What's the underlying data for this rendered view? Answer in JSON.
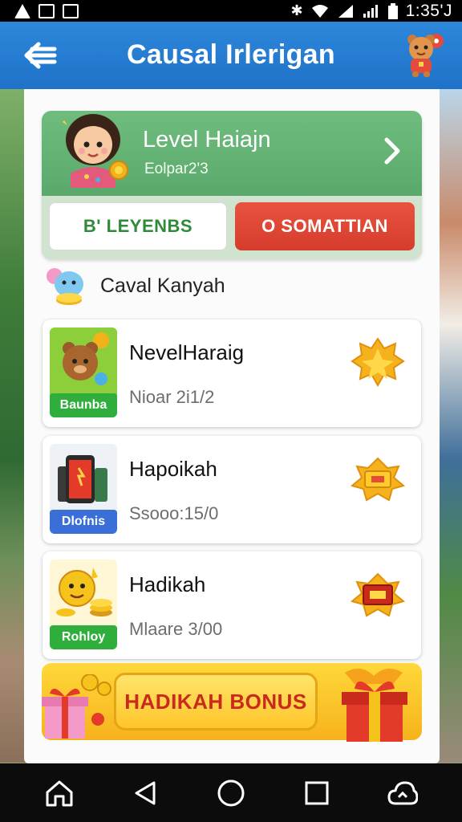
{
  "status_bar": {
    "time": "1:35'J",
    "bluetooth_glyph": "✱"
  },
  "app_bar": {
    "title": "Causal Irlerigan"
  },
  "level_card": {
    "title": "Level Haiajn",
    "subtitle": "Eolpar2'3",
    "left_button": "B' LEYENBS",
    "right_button": "O SOMATTIAN"
  },
  "section": {
    "title": "Caval Kanyah"
  },
  "rewards": [
    {
      "name": "NevelHaraig",
      "meta": "Nioar 2i1/2",
      "tag": "Baunba",
      "tag_color": "#2fae3c",
      "thumb_bg": "#8ccf3a",
      "badge": "star-badge-icon"
    },
    {
      "name": "Hapoikah",
      "meta": "Ssooo:15/0",
      "tag": "Dlofnis",
      "tag_color": "#3a6fd8",
      "thumb_bg": "#eef2f6",
      "badge": "gold-ticket-icon"
    },
    {
      "name": "Hadikah",
      "meta": "Mlaare 3/00",
      "tag": "Rohloy",
      "tag_color": "#2fae3c",
      "thumb_bg": "#fff6d6",
      "badge": "red-ticket-icon"
    }
  ],
  "bonus": {
    "label": "HADIKAH BONUS"
  },
  "colors": {
    "app_bar": "#1f72c9",
    "level_green": "#5aa86b",
    "button_red": "#d63c2c",
    "bonus_yellow": "#f6b21c"
  }
}
